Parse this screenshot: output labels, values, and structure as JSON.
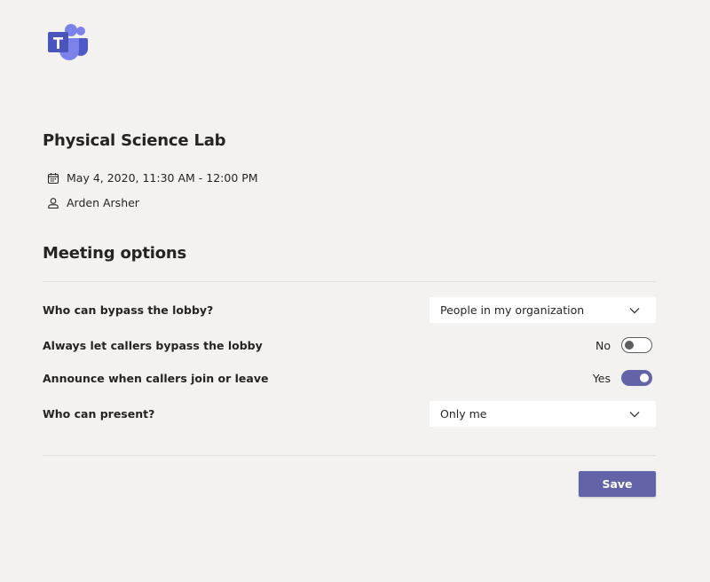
{
  "app": {
    "logo_icon": "microsoft-teams-logo",
    "brand_color": "#6264a7"
  },
  "meeting": {
    "title": "Physical Science Lab",
    "datetime": "May 4, 2020, 11:30 AM - 12:00 PM",
    "datetime_icon": "calendar-icon",
    "organizer": "Arden Arsher",
    "organizer_icon": "person-icon"
  },
  "options": {
    "heading": "Meeting options",
    "bypass_lobby": {
      "label": "Who can bypass the lobby?",
      "value": "People in my organization"
    },
    "callers_bypass": {
      "label": "Always let callers bypass the lobby",
      "state_label": "No",
      "enabled": false
    },
    "announce_callers": {
      "label": "Announce when callers join or leave",
      "state_label": "Yes",
      "enabled": true
    },
    "who_can_present": {
      "label": "Who can present?",
      "value": "Only me"
    }
  },
  "actions": {
    "save_label": "Save"
  }
}
